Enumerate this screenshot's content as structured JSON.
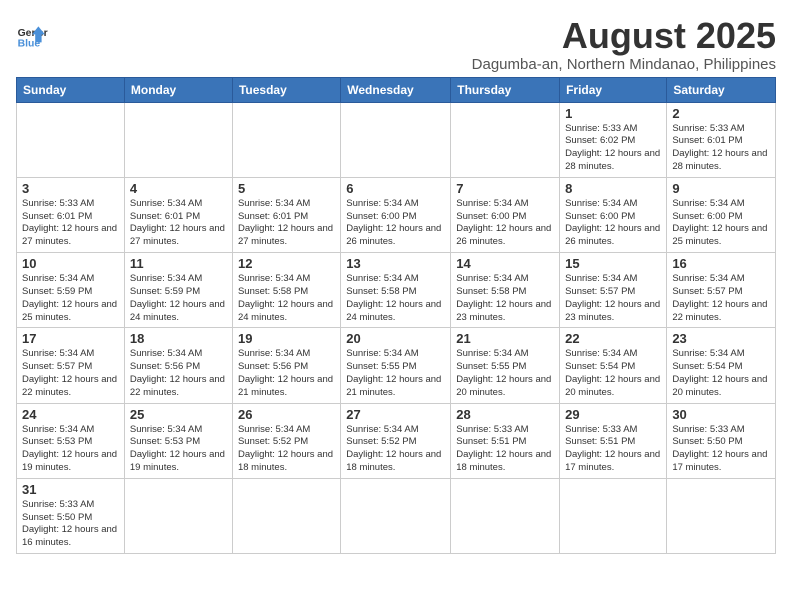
{
  "logo": {
    "line1": "General",
    "line2": "Blue"
  },
  "title": "August 2025",
  "subtitle": "Dagumba-an, Northern Mindanao, Philippines",
  "weekdays": [
    "Sunday",
    "Monday",
    "Tuesday",
    "Wednesday",
    "Thursday",
    "Friday",
    "Saturday"
  ],
  "weeks": [
    [
      {
        "day": "",
        "info": ""
      },
      {
        "day": "",
        "info": ""
      },
      {
        "day": "",
        "info": ""
      },
      {
        "day": "",
        "info": ""
      },
      {
        "day": "",
        "info": ""
      },
      {
        "day": "1",
        "info": "Sunrise: 5:33 AM\nSunset: 6:02 PM\nDaylight: 12 hours and 28 minutes."
      },
      {
        "day": "2",
        "info": "Sunrise: 5:33 AM\nSunset: 6:01 PM\nDaylight: 12 hours and 28 minutes."
      }
    ],
    [
      {
        "day": "3",
        "info": "Sunrise: 5:33 AM\nSunset: 6:01 PM\nDaylight: 12 hours and 27 minutes."
      },
      {
        "day": "4",
        "info": "Sunrise: 5:34 AM\nSunset: 6:01 PM\nDaylight: 12 hours and 27 minutes."
      },
      {
        "day": "5",
        "info": "Sunrise: 5:34 AM\nSunset: 6:01 PM\nDaylight: 12 hours and 27 minutes."
      },
      {
        "day": "6",
        "info": "Sunrise: 5:34 AM\nSunset: 6:00 PM\nDaylight: 12 hours and 26 minutes."
      },
      {
        "day": "7",
        "info": "Sunrise: 5:34 AM\nSunset: 6:00 PM\nDaylight: 12 hours and 26 minutes."
      },
      {
        "day": "8",
        "info": "Sunrise: 5:34 AM\nSunset: 6:00 PM\nDaylight: 12 hours and 26 minutes."
      },
      {
        "day": "9",
        "info": "Sunrise: 5:34 AM\nSunset: 6:00 PM\nDaylight: 12 hours and 25 minutes."
      }
    ],
    [
      {
        "day": "10",
        "info": "Sunrise: 5:34 AM\nSunset: 5:59 PM\nDaylight: 12 hours and 25 minutes."
      },
      {
        "day": "11",
        "info": "Sunrise: 5:34 AM\nSunset: 5:59 PM\nDaylight: 12 hours and 24 minutes."
      },
      {
        "day": "12",
        "info": "Sunrise: 5:34 AM\nSunset: 5:58 PM\nDaylight: 12 hours and 24 minutes."
      },
      {
        "day": "13",
        "info": "Sunrise: 5:34 AM\nSunset: 5:58 PM\nDaylight: 12 hours and 24 minutes."
      },
      {
        "day": "14",
        "info": "Sunrise: 5:34 AM\nSunset: 5:58 PM\nDaylight: 12 hours and 23 minutes."
      },
      {
        "day": "15",
        "info": "Sunrise: 5:34 AM\nSunset: 5:57 PM\nDaylight: 12 hours and 23 minutes."
      },
      {
        "day": "16",
        "info": "Sunrise: 5:34 AM\nSunset: 5:57 PM\nDaylight: 12 hours and 22 minutes."
      }
    ],
    [
      {
        "day": "17",
        "info": "Sunrise: 5:34 AM\nSunset: 5:57 PM\nDaylight: 12 hours and 22 minutes."
      },
      {
        "day": "18",
        "info": "Sunrise: 5:34 AM\nSunset: 5:56 PM\nDaylight: 12 hours and 22 minutes."
      },
      {
        "day": "19",
        "info": "Sunrise: 5:34 AM\nSunset: 5:56 PM\nDaylight: 12 hours and 21 minutes."
      },
      {
        "day": "20",
        "info": "Sunrise: 5:34 AM\nSunset: 5:55 PM\nDaylight: 12 hours and 21 minutes."
      },
      {
        "day": "21",
        "info": "Sunrise: 5:34 AM\nSunset: 5:55 PM\nDaylight: 12 hours and 20 minutes."
      },
      {
        "day": "22",
        "info": "Sunrise: 5:34 AM\nSunset: 5:54 PM\nDaylight: 12 hours and 20 minutes."
      },
      {
        "day": "23",
        "info": "Sunrise: 5:34 AM\nSunset: 5:54 PM\nDaylight: 12 hours and 20 minutes."
      }
    ],
    [
      {
        "day": "24",
        "info": "Sunrise: 5:34 AM\nSunset: 5:53 PM\nDaylight: 12 hours and 19 minutes."
      },
      {
        "day": "25",
        "info": "Sunrise: 5:34 AM\nSunset: 5:53 PM\nDaylight: 12 hours and 19 minutes."
      },
      {
        "day": "26",
        "info": "Sunrise: 5:34 AM\nSunset: 5:52 PM\nDaylight: 12 hours and 18 minutes."
      },
      {
        "day": "27",
        "info": "Sunrise: 5:34 AM\nSunset: 5:52 PM\nDaylight: 12 hours and 18 minutes."
      },
      {
        "day": "28",
        "info": "Sunrise: 5:33 AM\nSunset: 5:51 PM\nDaylight: 12 hours and 18 minutes."
      },
      {
        "day": "29",
        "info": "Sunrise: 5:33 AM\nSunset: 5:51 PM\nDaylight: 12 hours and 17 minutes."
      },
      {
        "day": "30",
        "info": "Sunrise: 5:33 AM\nSunset: 5:50 PM\nDaylight: 12 hours and 17 minutes."
      }
    ],
    [
      {
        "day": "31",
        "info": "Sunrise: 5:33 AM\nSunset: 5:50 PM\nDaylight: 12 hours and 16 minutes."
      },
      {
        "day": "",
        "info": ""
      },
      {
        "day": "",
        "info": ""
      },
      {
        "day": "",
        "info": ""
      },
      {
        "day": "",
        "info": ""
      },
      {
        "day": "",
        "info": ""
      },
      {
        "day": "",
        "info": ""
      }
    ]
  ]
}
